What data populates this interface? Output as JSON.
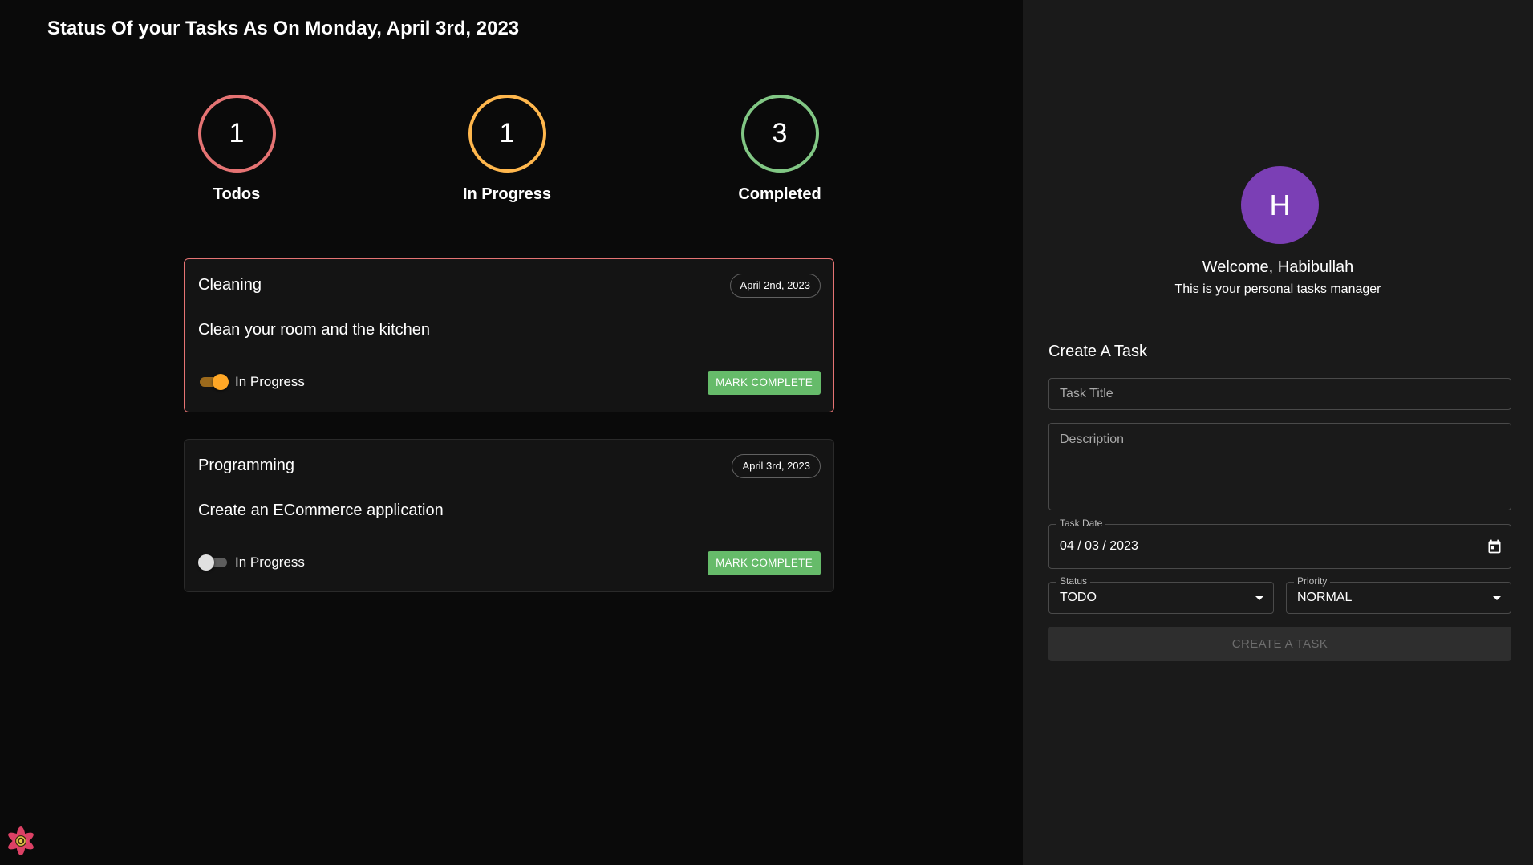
{
  "header": {
    "title": "Status Of your Tasks As On Monday, April 3rd, 2023"
  },
  "stats": [
    {
      "count": "1",
      "label": "Todos",
      "color": "#e57373"
    },
    {
      "count": "1",
      "label": "In Progress",
      "color": "#ffb74d"
    },
    {
      "count": "3",
      "label": "Completed",
      "color": "#81c784"
    }
  ],
  "tasks": [
    {
      "title": "Cleaning",
      "date": "April 2nd, 2023",
      "description": "Clean your room and the kitchen",
      "toggle_label": "In Progress",
      "toggle_on": true,
      "button_label": "MARK COMPLETE"
    },
    {
      "title": "Programming",
      "date": "April 3rd, 2023",
      "description": "Create an ECommerce application",
      "toggle_label": "In Progress",
      "toggle_on": false,
      "button_label": "MARK COMPLETE"
    }
  ],
  "sidebar": {
    "avatar_letter": "H",
    "avatar_color": "#7b3fb5",
    "welcome": "Welcome, Habibullah",
    "subtitle": "This is your personal tasks manager",
    "form": {
      "heading": "Create A Task",
      "title_placeholder": "Task Title",
      "description_placeholder": "Description",
      "date_label": "Task Date",
      "date_value": "04 / 03 / 2023",
      "status_label": "Status",
      "status_value": "TODO",
      "priority_label": "Priority",
      "priority_value": "NORMAL",
      "submit_label": "CREATE A TASK"
    }
  },
  "icons": {
    "calendar": "calendar-icon",
    "dropdown": "chevron-down-icon",
    "react_logo": "react-logo-icon"
  },
  "colors": {
    "accent_green": "#66bb6a",
    "toggle_orange": "#ffa726",
    "card_highlight": "#e57373"
  }
}
